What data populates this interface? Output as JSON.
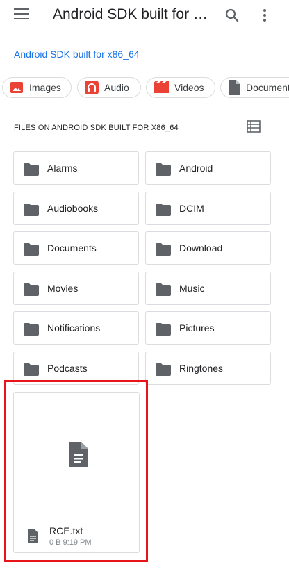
{
  "app_bar": {
    "title": "Android SDK built for x86_64",
    "menu_icon": "hamburger-menu-icon",
    "search_icon": "search-icon",
    "more_icon": "more-vert-icon"
  },
  "breadcrumb": "Android SDK built for x86_64",
  "chips": [
    {
      "label": "Images",
      "icon": "image-icon",
      "color": "#ea4335"
    },
    {
      "label": "Audio",
      "icon": "headphones-icon",
      "color": "#ea4335"
    },
    {
      "label": "Videos",
      "icon": "movie-icon",
      "color": "#ea4335"
    },
    {
      "label": "Documents",
      "icon": "document-icon",
      "color": "#5f6368"
    }
  ],
  "section": {
    "label": "FILES ON ANDROID SDK BUILT FOR X86_64",
    "view_toggle_icon": "list-view-icon"
  },
  "folders": [
    "Alarms",
    "Android",
    "Audiobooks",
    "DCIM",
    "Documents",
    "Download",
    "Movies",
    "Music",
    "Notifications",
    "Pictures",
    "Podcasts",
    "Ringtones"
  ],
  "file": {
    "name": "RCE.txt",
    "meta": "0 B 9:19 PM",
    "icon": "text-file-icon"
  },
  "colors": {
    "accent": "#1a73e8",
    "highlight": "#e8141a",
    "icon_gray": "#5f6368"
  }
}
